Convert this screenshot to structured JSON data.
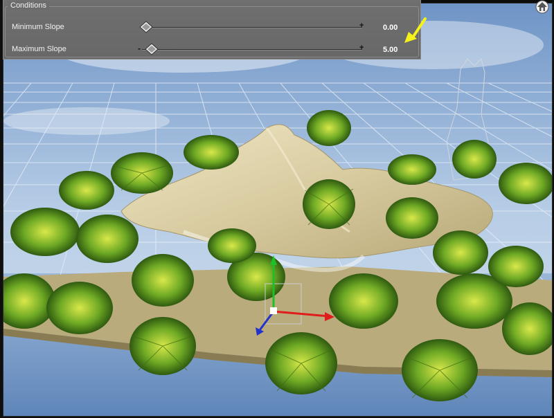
{
  "panel": {
    "title": "Conditions",
    "sliders": [
      {
        "label": "Minimum Slope",
        "value": "0.00",
        "fraction": 0.0
      },
      {
        "label": "Maximum Slope",
        "value": "5.00",
        "fraction": 0.05
      }
    ],
    "minus_glyph": "-",
    "plus_glyph": "+"
  },
  "icons": {
    "home_button": "home-icon",
    "annotation": "yellow-arrow-icon",
    "gizmo": "transform-gizmo-icon"
  },
  "colors": {
    "sky": "#a8c4e2",
    "grid": "#dfe8f4",
    "sand": "#d8cfa6",
    "palm": "#7fb52a",
    "arrow": "#f5f21a"
  }
}
